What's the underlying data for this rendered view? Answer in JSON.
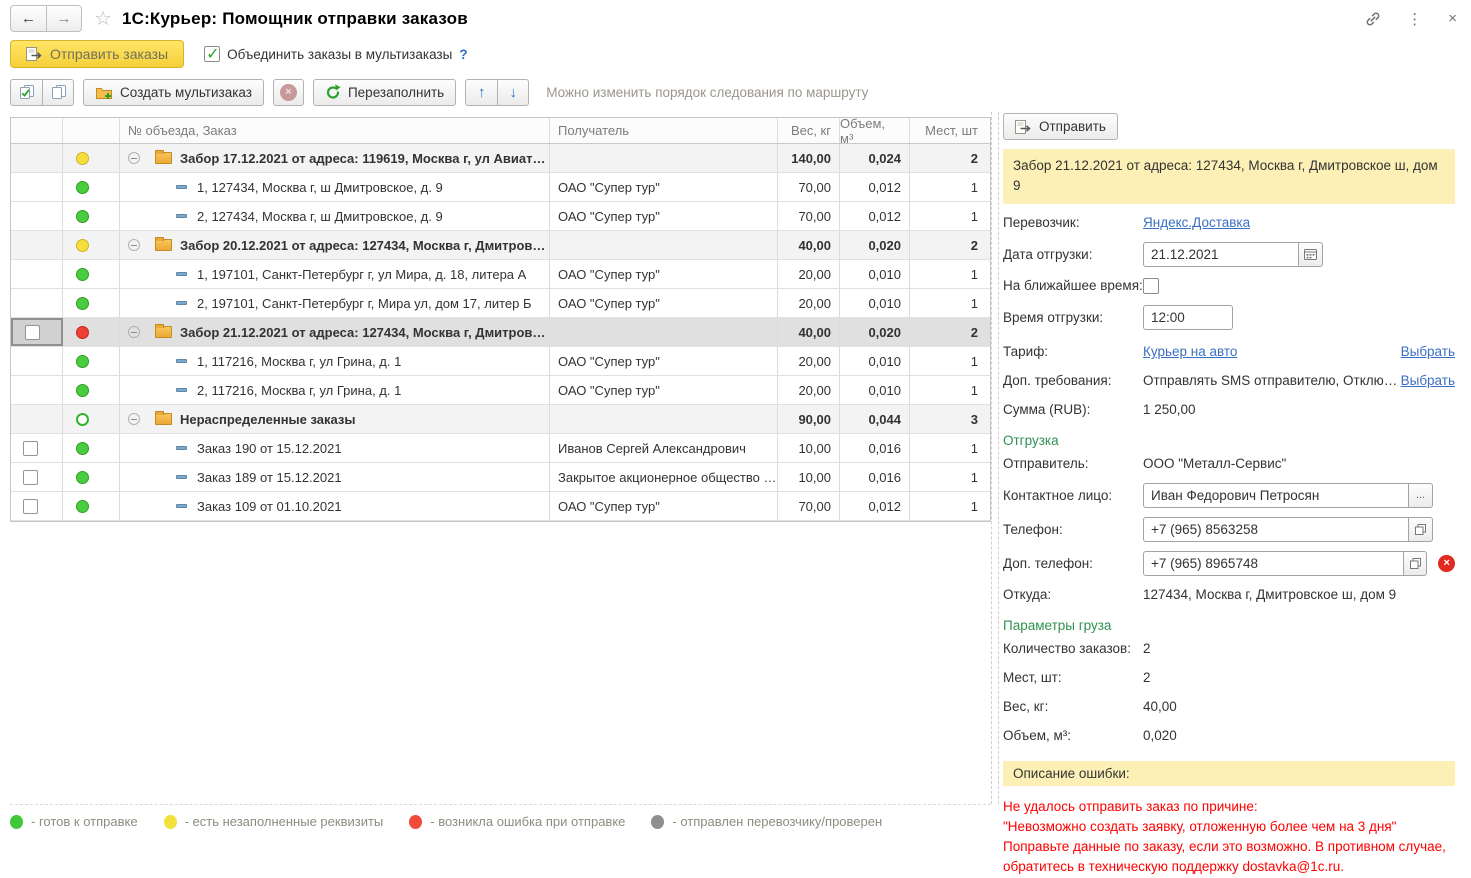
{
  "header": {
    "title": "1С:Курьер: Помощник отправки заказов",
    "back": "←",
    "forward": "→",
    "star": "☆",
    "menu": "⋮",
    "close": "×"
  },
  "actions": {
    "send_orders": "Отправить заказы",
    "merge_label": "Объединить заказы в мультизаказы",
    "merge_checked": true,
    "help": "?"
  },
  "toolbar": {
    "create_multiorder": "Создать мультизаказ",
    "cancel_glyph": "×",
    "refill": "Перезаполнить",
    "up": "↑",
    "down": "↓",
    "hint": "Можно изменить порядок следования по маршруту"
  },
  "table": {
    "columns": {
      "order": "№ объезда, Заказ",
      "recipient": "Получатель",
      "weight": "Вес, кг",
      "volume": "Объем, м³",
      "places": "Мест, шт"
    },
    "rows": [
      {
        "type": "group",
        "status": "yellow",
        "text": "Забор 17.12.2021 от адреса: 119619, Москва г, ул Авиат…",
        "recipient": "",
        "weight": "140,00",
        "volume": "0,024",
        "places": "2"
      },
      {
        "type": "order",
        "status": "green",
        "text": "1, 127434, Москва г, ш Дмитровское, д. 9",
        "recipient": "ОАО \"Супер тур\"",
        "weight": "70,00",
        "volume": "0,012",
        "places": "1"
      },
      {
        "type": "order",
        "status": "green",
        "text": "2, 127434, Москва г, ш Дмитровское, д. 9",
        "recipient": "ОАО \"Супер тур\"",
        "weight": "70,00",
        "volume": "0,012",
        "places": "1"
      },
      {
        "type": "group",
        "status": "yellow",
        "text": "Забор 20.12.2021 от адреса: 127434, Москва г, Дмитров…",
        "recipient": "",
        "weight": "40,00",
        "volume": "0,020",
        "places": "2"
      },
      {
        "type": "order",
        "status": "green",
        "text": "1, 197101, Санкт-Петербург г, ул Мира, д. 18, литера А",
        "recipient": "ОАО \"Супер тур\"",
        "weight": "20,00",
        "volume": "0,010",
        "places": "1"
      },
      {
        "type": "order",
        "status": "green",
        "text": "2, 197101, Санкт-Петербург г, Мира ул, дом 17, литер Б",
        "recipient": "ОАО \"Супер тур\"",
        "weight": "20,00",
        "volume": "0,010",
        "places": "1"
      },
      {
        "type": "group",
        "status": "red",
        "selected": true,
        "checkbox": false,
        "text": "Забор 21.12.2021 от адреса: 127434, Москва г, Дмитров…",
        "recipient": "",
        "weight": "40,00",
        "volume": "0,020",
        "places": "2"
      },
      {
        "type": "order",
        "status": "green",
        "text": "1, 117216, Москва г, ул Грина, д. 1",
        "recipient": "ОАО \"Супер тур\"",
        "weight": "20,00",
        "volume": "0,010",
        "places": "1"
      },
      {
        "type": "order",
        "status": "green",
        "text": "2, 117216, Москва г, ул Грина, д. 1",
        "recipient": "ОАО \"Супер тур\"",
        "weight": "20,00",
        "volume": "0,010",
        "places": "1"
      },
      {
        "type": "group",
        "status": "green-hollow",
        "text": "Нераспределенные заказы",
        "recipient": "",
        "weight": "90,00",
        "volume": "0,044",
        "places": "3"
      },
      {
        "type": "order",
        "status": "green",
        "checkbox": false,
        "text": "Заказ 190 от 15.12.2021",
        "recipient": "Иванов Сергей Александрович",
        "weight": "10,00",
        "volume": "0,016",
        "places": "1"
      },
      {
        "type": "order",
        "status": "green",
        "checkbox": false,
        "text": "Заказ 189 от 15.12.2021",
        "recipient": "Закрытое акционерное общество …",
        "weight": "10,00",
        "volume": "0,016",
        "places": "1"
      },
      {
        "type": "order",
        "status": "green",
        "checkbox": false,
        "text": "Заказ 109 от 01.10.2021",
        "recipient": "ОАО \"Супер тур\"",
        "weight": "70,00",
        "volume": "0,012",
        "places": "1"
      }
    ]
  },
  "panel": {
    "send": "Отправить",
    "banner": "Забор 21.12.2021 от адреса: 127434, Москва г, Дмитровское ш, дом 9",
    "carrier_label": "Перевозчик:",
    "carrier": "Яндекс.Доставка",
    "ship_date_label": "Дата отгрузки:",
    "ship_date": "21.12.2021",
    "asap_label": "На ближайшее время:",
    "ship_time_label": "Время отгрузки:",
    "ship_time": "12:00",
    "tariff_label": "Тариф:",
    "tariff": "Курьер на авто",
    "choose": "Выбрать",
    "requirements_label": "Доп. требования:",
    "requirements": "Отправлять SMS отправителю, Отклю…",
    "sum_label": "Сумма (RUB):",
    "sum": "1 250,00",
    "shipping_section": "Отгрузка",
    "sender_label": "Отправитель:",
    "sender": "ООО \"Металл-Сервис\"",
    "contact_label": "Контактное лицо:",
    "contact": "Иван Федорович Петросян",
    "contact_more": "...",
    "phone_label": "Телефон:",
    "phone": "+7 (965) 8563258",
    "phone2_label": "Доп. телефон:",
    "phone2": "+7 (965) 8965748",
    "clear_glyph": "×",
    "from_label": "Откуда:",
    "from": "127434, Москва г, Дмитровское ш, дом 9",
    "cargo_section": "Параметры груза",
    "orders_count_label": "Количество заказов:",
    "orders_count": "2",
    "places_label": "Мест, шт:",
    "places": "2",
    "weight_label": "Вес, кг:",
    "weight": "40,00",
    "volume_label": "Объем, м³:",
    "volume": "0,020",
    "error_header": "Описание ошибки:",
    "error_text": "Не удалось отправить заказ по причине:\n\"Невозможно создать заявку, отложенную более чем на 3 дня\"\nПоправьте данные по заказу, если это возможно. В противном случае, обратитесь в техническую поддержку dostavka@1c.ru."
  },
  "legend": [
    {
      "color": "#41c73a",
      "label": "- готов к отправке"
    },
    {
      "color": "#f2e03c",
      "label": "- есть незаполненные реквизиты"
    },
    {
      "color": "#f04a3c",
      "label": "- возникла ошибка при отправке"
    },
    {
      "color": "#8f8f8f",
      "label": "- отправлен перевозчику/проверен"
    }
  ]
}
